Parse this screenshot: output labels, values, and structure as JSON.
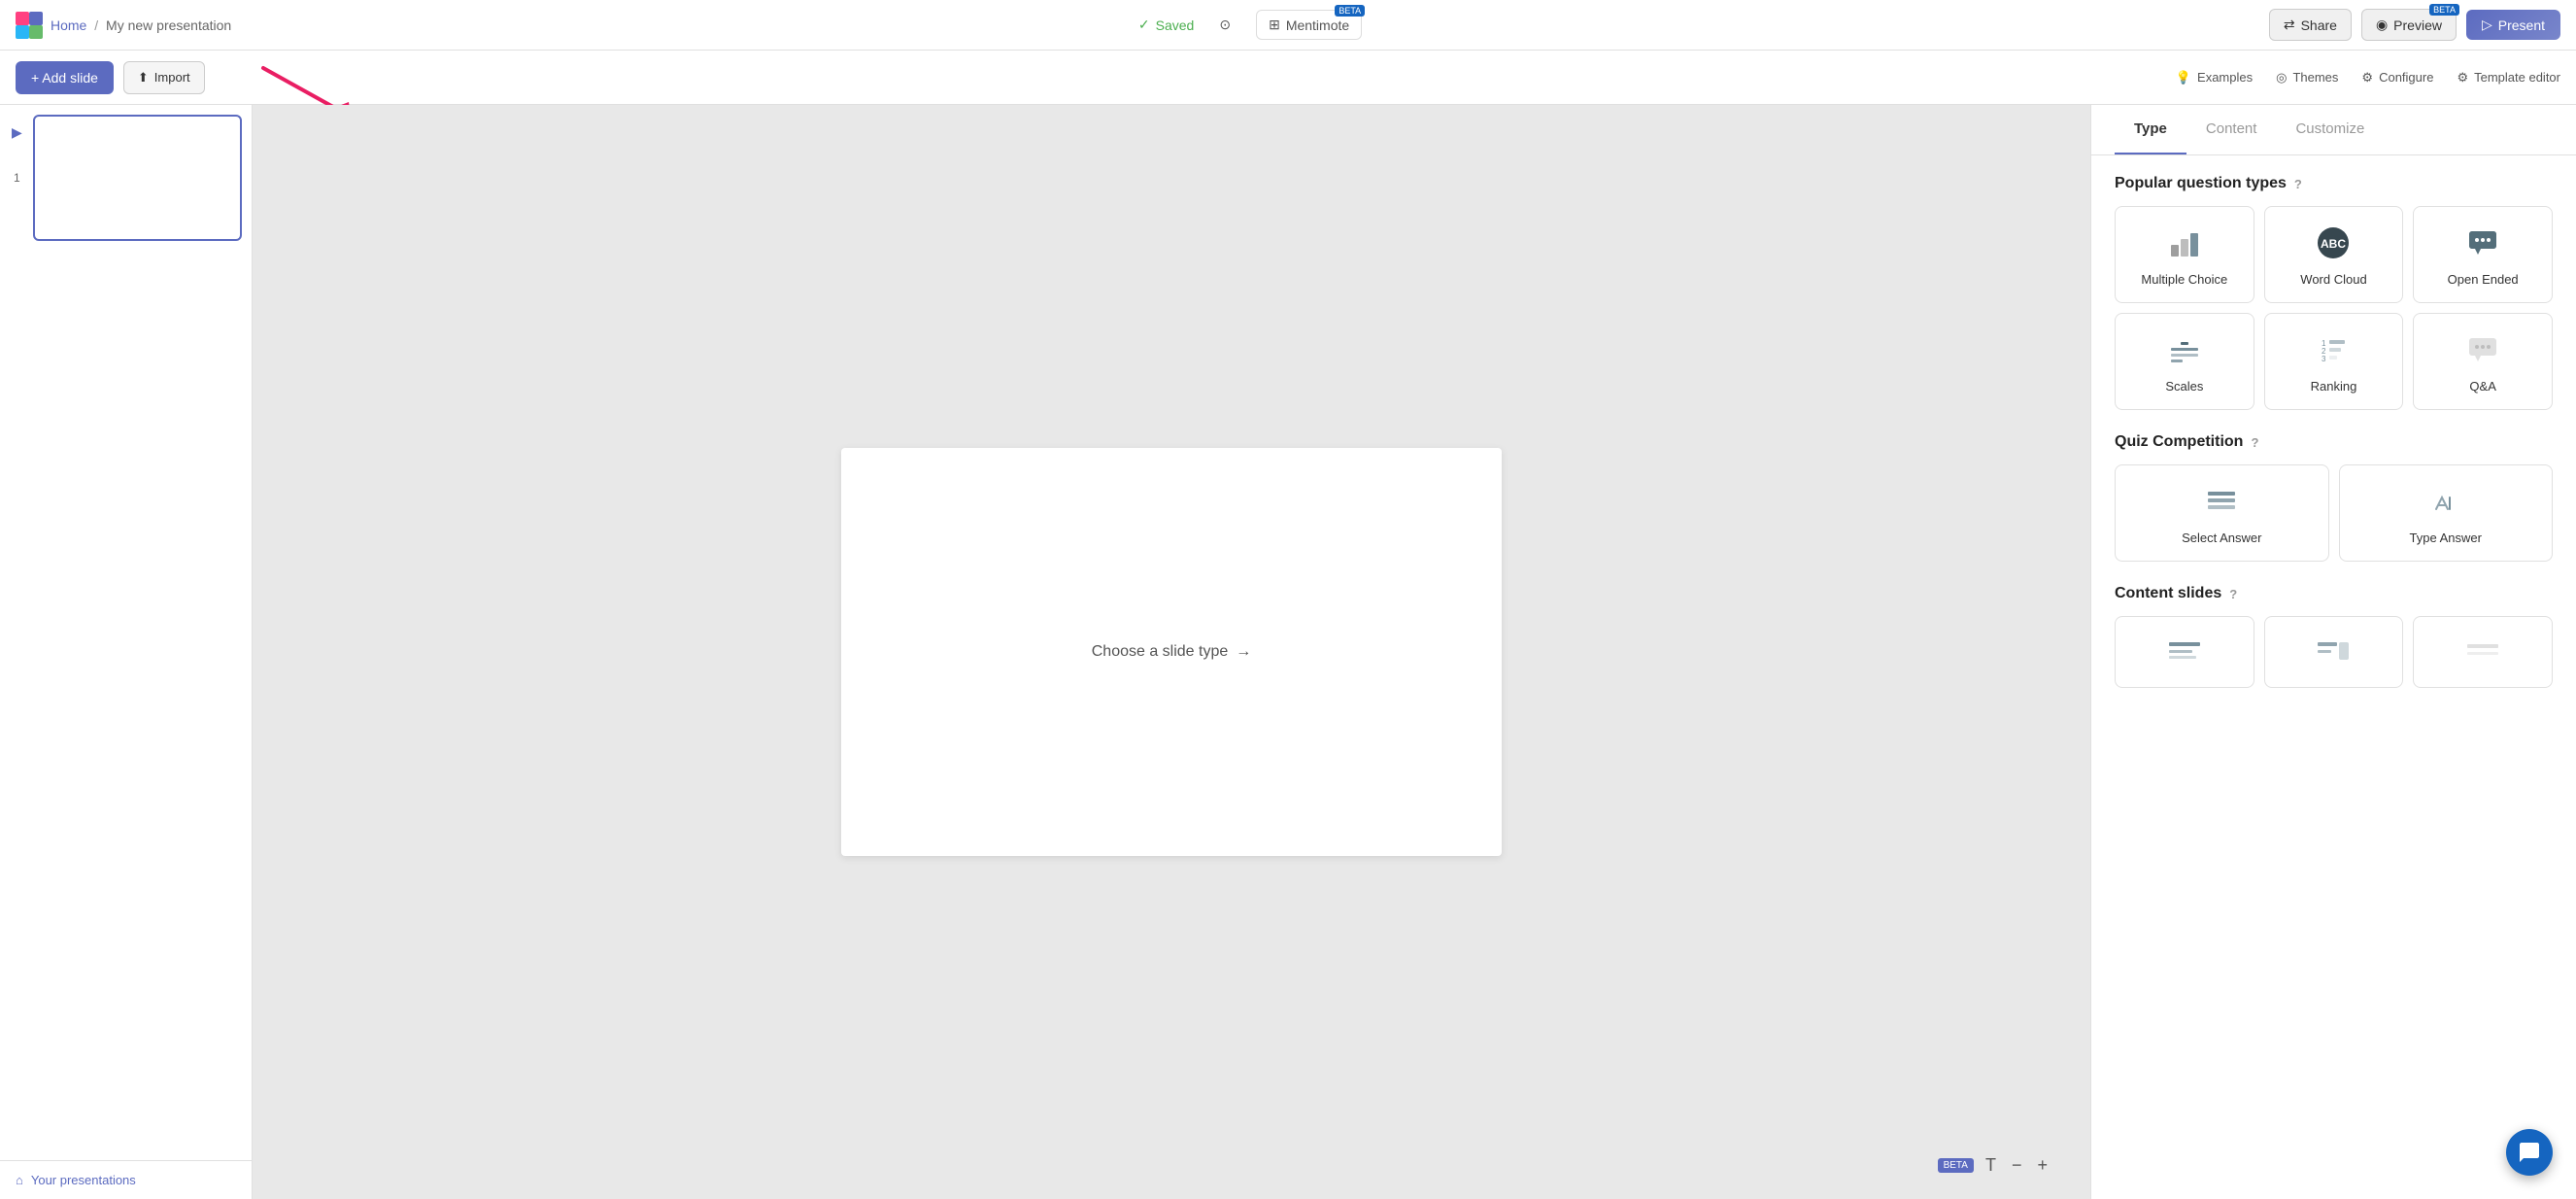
{
  "app": {
    "logo_alt": "Mentimeter logo"
  },
  "topnav": {
    "breadcrumb_home": "Home",
    "breadcrumb_separator": "/",
    "breadcrumb_current": "My new presentation",
    "saved_label": "Saved",
    "help_label": "?",
    "mentimote_label": "Mentimote",
    "mentimote_beta": "BETA",
    "share_label": "Share",
    "preview_label": "Preview",
    "preview_beta": "BETA",
    "present_label": "Present"
  },
  "toolbar": {
    "add_slide_label": "+ Add slide",
    "import_label": "Import",
    "examples_label": "Examples",
    "themes_label": "Themes",
    "configure_label": "Configure",
    "template_editor_label": "Template editor"
  },
  "sidebar": {
    "slide_number": "1",
    "your_presentations_label": "Your presentations"
  },
  "canvas": {
    "choose_slide_text": "Choose a slide type",
    "choose_slide_arrow": "→",
    "beta_label": "BETA",
    "text_tool": "T",
    "zoom_out": "−",
    "zoom_in": "+"
  },
  "right_panel": {
    "tabs": [
      {
        "id": "type",
        "label": "Type",
        "active": true
      },
      {
        "id": "content",
        "label": "Content",
        "active": false
      },
      {
        "id": "customize",
        "label": "Customize",
        "active": false
      }
    ],
    "popular_section": {
      "title": "Popular question types",
      "help_icon": "?"
    },
    "quiz_section": {
      "title": "Quiz Competition",
      "help_icon": "?"
    },
    "content_section": {
      "title": "Content slides",
      "help_icon": "?"
    },
    "popular_types": [
      {
        "id": "multiple-choice",
        "label": "Multiple Choice",
        "icon_type": "bar-chart"
      },
      {
        "id": "word-cloud",
        "label": "Word Cloud",
        "icon_type": "word-cloud"
      },
      {
        "id": "open-ended",
        "label": "Open Ended",
        "icon_type": "chat"
      }
    ],
    "popular_types_row2": [
      {
        "id": "scales",
        "label": "Scales",
        "icon_type": "scales"
      },
      {
        "id": "ranking",
        "label": "Ranking",
        "icon_type": "ranking"
      },
      {
        "id": "qa",
        "label": "Q&A",
        "icon_type": "qa"
      }
    ],
    "quiz_types": [
      {
        "id": "select-answer",
        "label": "Select Answer",
        "icon_type": "select-answer"
      },
      {
        "id": "type-answer",
        "label": "Type Answer",
        "icon_type": "type-answer"
      }
    ]
  }
}
